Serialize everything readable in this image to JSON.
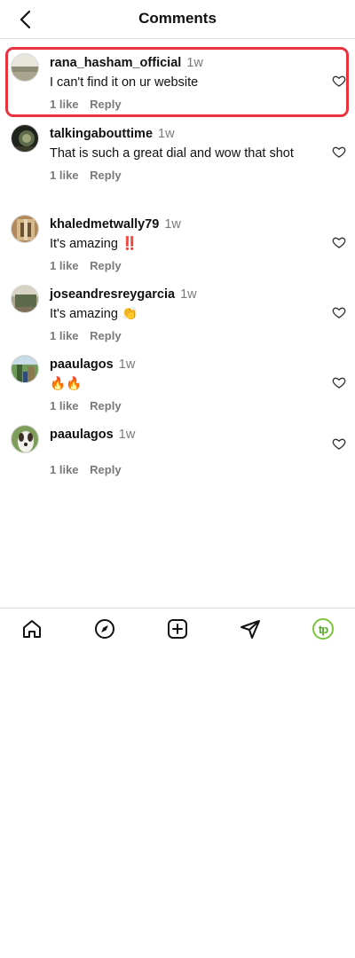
{
  "header": {
    "title": "Comments",
    "back_icon": "chevron-left-icon"
  },
  "comments": [
    {
      "username": "rana_hasham_official",
      "time": "1w",
      "text": "I can't find it on ur website",
      "likes": "1 like",
      "reply": "Reply",
      "highlighted": true
    },
    {
      "username": "talkingabouttime",
      "time": "1w",
      "text": "That is such a great dial and wow that shot",
      "likes": "1 like",
      "reply": "Reply"
    },
    {
      "username": "khaledmetwally79",
      "time": "1w",
      "text": "It's amazing ‼️",
      "likes": "1 like",
      "reply": "Reply"
    },
    {
      "username": "joseandresreygarcia",
      "time": "1w",
      "text": "It's amazing 👏",
      "likes": "1 like",
      "reply": "Reply"
    },
    {
      "username": "paaulagos",
      "time": "1w",
      "text": "🔥🔥",
      "likes": "1 like",
      "reply": "Reply"
    },
    {
      "username": "paaulagos",
      "time": "1w",
      "text": "",
      "likes": "1 like",
      "reply": "Reply"
    }
  ],
  "tabbar": {
    "icons": [
      "home-icon",
      "explore-compass-icon",
      "create-plus-icon",
      "direct-send-icon",
      "profile-tp-logo"
    ],
    "logo_text": "tp"
  },
  "colors": {
    "highlight": "#e8333f",
    "meta_text": "#7a7a7a",
    "logo_green": "#7cc53c"
  }
}
